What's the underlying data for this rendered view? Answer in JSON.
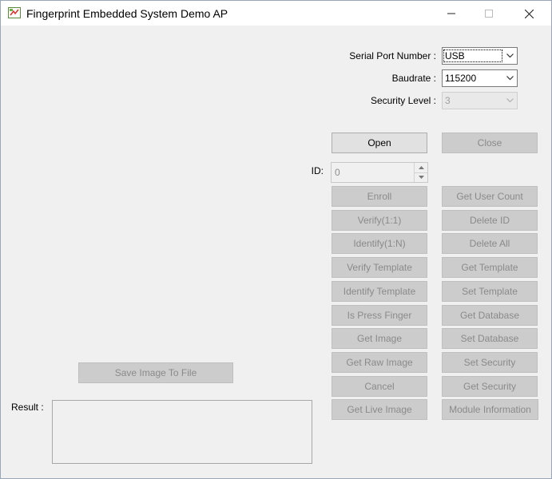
{
  "window": {
    "title": "Fingerprint Embedded System Demo AP",
    "icon": "fingerprint-app-icon",
    "controls": {
      "minimize": "minimize-icon",
      "maximize": "maximize-icon",
      "close": "close-icon"
    }
  },
  "settings": {
    "serial_port": {
      "label": "Serial Port Number :",
      "value": "USB"
    },
    "baudrate": {
      "label": "Baudrate :",
      "value": "115200"
    },
    "security_level": {
      "label": "Security Level :",
      "value": "3"
    }
  },
  "connection": {
    "open_label": "Open",
    "close_label": "Close"
  },
  "id_field": {
    "label": "ID:",
    "value": "0"
  },
  "commands_left": [
    "Enroll",
    "Verify(1:1)",
    "Identify(1:N)",
    "Verify Template",
    "Identify Template",
    "Is Press Finger",
    "Get Image",
    "Get Raw Image",
    "Cancel",
    "Get Live Image"
  ],
  "commands_right": [
    "Get User Count",
    "Delete ID",
    "Delete All",
    "Get Template",
    "Set Template",
    "Get Database",
    "Set Database",
    "Set Security",
    "Get Security",
    "Module Information"
  ],
  "image_panel": {
    "save_label": "Save Image To File"
  },
  "result": {
    "label": "Result :",
    "text": ""
  },
  "colors": {
    "window_bg": "#f0f0f0",
    "disabled_button": "#cccccc",
    "button": "#e1e1e1"
  }
}
